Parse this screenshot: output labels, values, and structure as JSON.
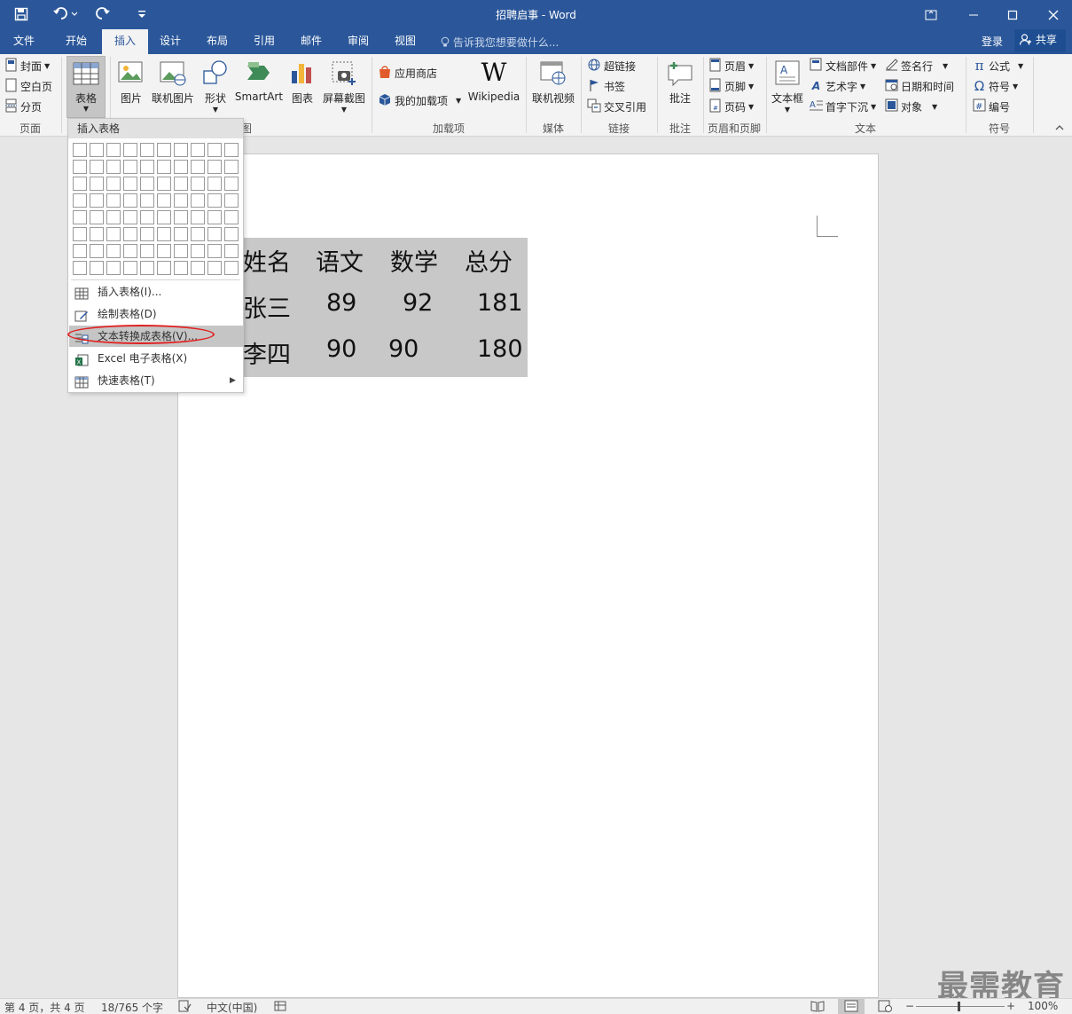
{
  "app": {
    "title": "招聘启事 - Word",
    "login": "登录",
    "share": "共享",
    "tell_me": "告诉我您想要做什么..."
  },
  "tabs": [
    "文件",
    "开始",
    "插入",
    "设计",
    "布局",
    "引用",
    "邮件",
    "审阅",
    "视图"
  ],
  "active_tab": "插入",
  "ribbon": {
    "pages": {
      "cover": "封面",
      "blank": "空白页",
      "break": "分页",
      "group": "页面"
    },
    "tables": {
      "table": "表格"
    },
    "illustrations": {
      "picture": "图片",
      "online_picture": "联机图片",
      "shapes": "形状",
      "smartart": "SmartArt",
      "chart": "图表",
      "screenshot": "屏幕截图",
      "group_suffix": "图"
    },
    "addins": {
      "store": "应用商店",
      "my_addins": "我的加载项",
      "wikipedia": "Wikipedia",
      "group": "加载项"
    },
    "media": {
      "online_video": "联机视频",
      "group": "媒体"
    },
    "links": {
      "hyperlink": "超链接",
      "bookmark": "书签",
      "cross_ref": "交叉引用",
      "group": "链接"
    },
    "comments": {
      "comment": "批注",
      "group": "批注"
    },
    "header_footer": {
      "header": "页眉",
      "footer": "页脚",
      "page_number": "页码",
      "group": "页眉和页脚"
    },
    "text": {
      "textbox": "文本框",
      "quick_parts": "文档部件",
      "wordart": "艺术字",
      "dropcap": "首字下沉",
      "signature": "签名行",
      "datetime": "日期和时间",
      "object": "对象",
      "group": "文本"
    },
    "symbols": {
      "equation": "公式",
      "symbol": "符号",
      "number": "编号",
      "group": "符号"
    }
  },
  "dropdown": {
    "header": "插入表格",
    "items": [
      {
        "label": "插入表格(I)...",
        "icon": "table-icon"
      },
      {
        "label": "绘制表格(D)",
        "icon": "pencil-table-icon"
      },
      {
        "label": "文本转换成表格(V)...",
        "icon": "convert-text-icon",
        "highlighted": true
      },
      {
        "label": "Excel 电子表格(X)",
        "icon": "excel-icon"
      },
      {
        "label": "快速表格(T)",
        "icon": "quick-table-icon",
        "submenu": true
      }
    ],
    "grid_cols": 10,
    "grid_rows": 8
  },
  "document": {
    "table": [
      [
        "姓名",
        "语文",
        "数学",
        "总分"
      ],
      [
        "张三",
        "89",
        "92",
        "181"
      ],
      [
        "李四",
        "90",
        "90",
        "180"
      ]
    ]
  },
  "status": {
    "page": "第 4 页，共 4 页",
    "words": "18/765 个字",
    "language": "中文(中国)",
    "zoom": "100%"
  },
  "watermark": "最需教育",
  "colors": {
    "title_bar": "#2b579a",
    "highlight": "#c5c5c5",
    "annotation": "#e02020"
  }
}
